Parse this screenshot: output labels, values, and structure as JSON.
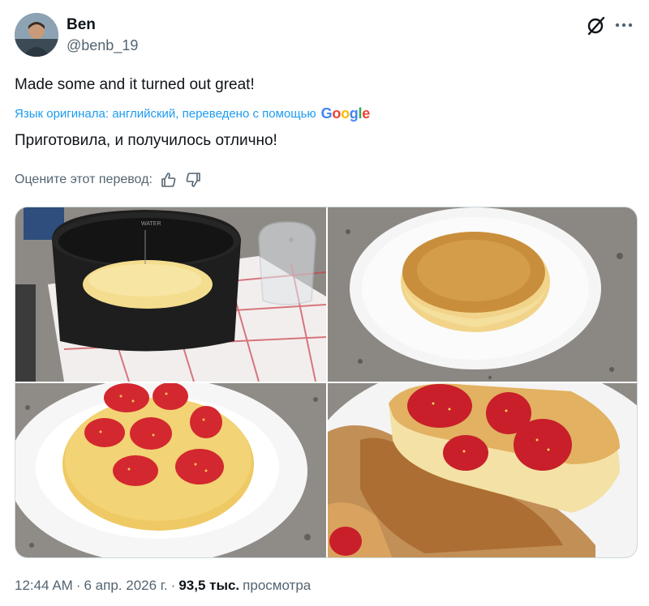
{
  "author": {
    "name": "Ben",
    "handle": "@benb_19"
  },
  "header_icons": {
    "grok": "grok-icon",
    "more": "more-dots-icon"
  },
  "post": {
    "text_original": "Made some and it turned out great!",
    "translation_note": "Язык оригинала: английский, переведено с помощью",
    "translator_brand": "Google",
    "text_translated": "Приготовила, и получилось отлично!",
    "rate_prompt": "Оцените этот перевод:"
  },
  "media": {
    "count": 4,
    "icons": [
      "photo-rice-cooker-cake",
      "photo-cake-on-plate",
      "photo-cake-with-strawberries",
      "photo-cake-slice-with-syrup"
    ]
  },
  "meta": {
    "time": "12:44 AM",
    "date": "6 апр. 2026 г.",
    "views_count": "93,5 тыс.",
    "views_label": "просмотра"
  },
  "colors": {
    "accent": "#1d9bf0",
    "text": "#0f1419",
    "secondary": "#536471",
    "google_blue": "#4285f4",
    "google_red": "#ea4335",
    "google_yellow": "#fbbc05",
    "google_green": "#34a853"
  }
}
